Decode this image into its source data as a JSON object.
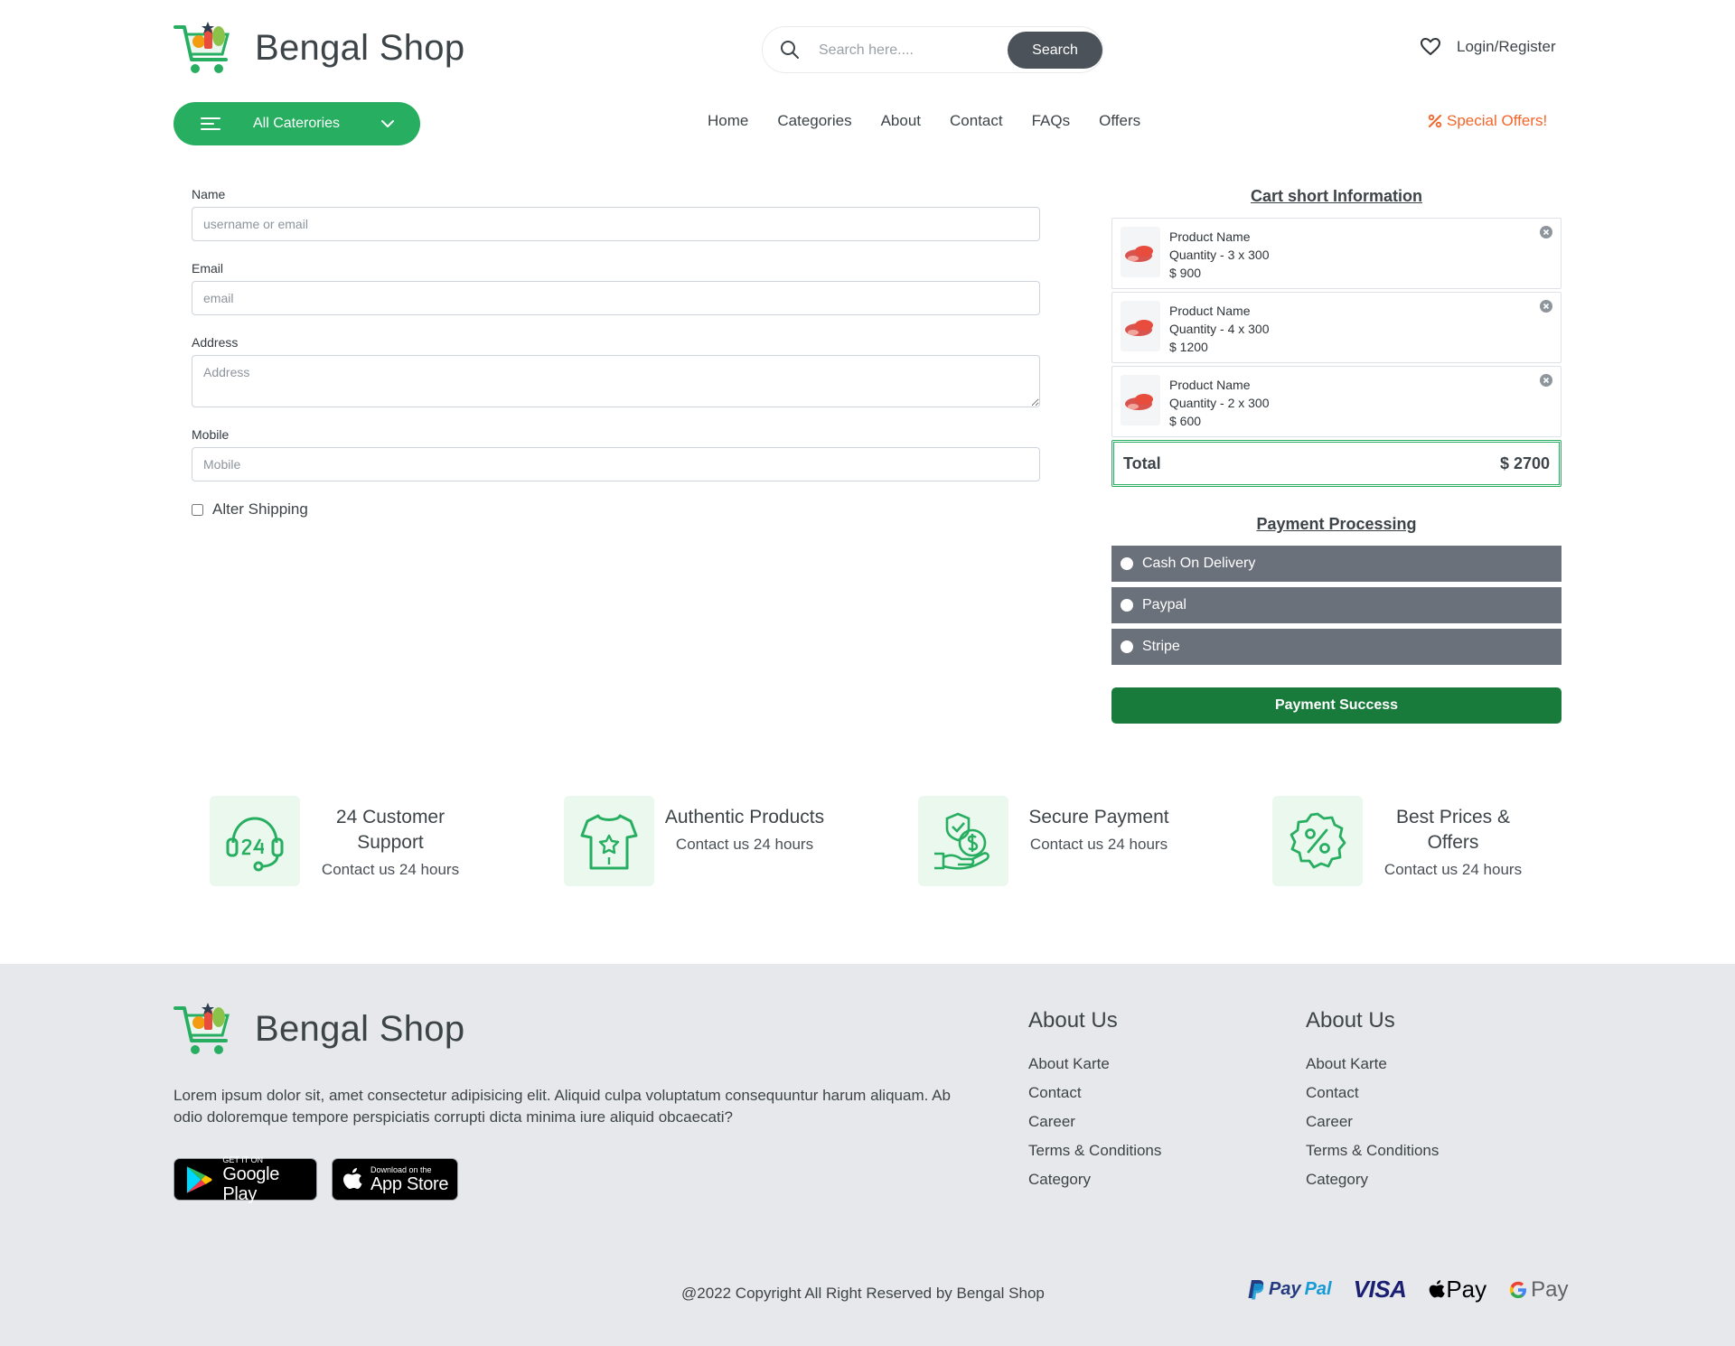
{
  "header": {
    "brand": "Bengal Shop",
    "search": {
      "placeholder": "Search here....",
      "button": "Search"
    },
    "login": "Login/Register",
    "categories_button": "All Caterories",
    "nav": [
      "Home",
      "Categories",
      "About",
      "Contact",
      "FAQs",
      "Offers"
    ],
    "special_offers": "Special Offers!"
  },
  "form": {
    "name": {
      "label": "Name",
      "placeholder": "username or email"
    },
    "email": {
      "label": "Email",
      "placeholder": "email"
    },
    "address": {
      "label": "Address",
      "placeholder": "Address"
    },
    "mobile": {
      "label": "Mobile",
      "placeholder": "Mobile"
    },
    "alter_shipping": "Alter Shipping"
  },
  "cart": {
    "title": "Cart short Information",
    "items": [
      {
        "name": "Product Name",
        "quantity": "Quantity - 3 x 300",
        "price": "$ 900"
      },
      {
        "name": "Product Name",
        "quantity": "Quantity - 4 x 300",
        "price": "$ 1200"
      },
      {
        "name": "Product Name",
        "quantity": "Quantity - 2 x 300",
        "price": "$ 600"
      }
    ],
    "total_label": "Total",
    "total_value": "$ 2700"
  },
  "payment": {
    "title": "Payment Processing",
    "options": [
      "Cash On Delivery",
      "Paypal",
      "Stripe"
    ],
    "button": "Payment Success"
  },
  "features": [
    {
      "icon": "headset-24-icon",
      "title": "24 Customer Support",
      "sub": "Contact us 24 hours"
    },
    {
      "icon": "tshirt-badge-icon",
      "title": "Authentic Products",
      "sub": "Contact us 24 hours"
    },
    {
      "icon": "secure-payment-icon",
      "title": "Secure Payment",
      "sub": "Contact us 24 hours"
    },
    {
      "icon": "discount-badge-icon",
      "title": "Best Prices & Offers",
      "sub": "Contact us 24 hours"
    }
  ],
  "footer": {
    "brand": "Bengal Shop",
    "description": "Lorem ipsum dolor sit, amet consectetur adipisicing elit. Aliquid culpa voluptatum consequuntur harum aliquam. Ab odio doloremque tempore perspiciatis corrupti dicta minima iure aliquid obcaecati?",
    "google_play": {
      "small": "GET IT ON",
      "big": "Google Play"
    },
    "app_store": {
      "small": "Download on the",
      "big": "App Store"
    },
    "columns": [
      {
        "title": "About Us",
        "links": [
          "About Karte",
          "Contact",
          "Career",
          "Terms & Conditions",
          "Category"
        ]
      },
      {
        "title": "About Us",
        "links": [
          "About Karte",
          "Contact",
          "Career",
          "Terms & Conditions",
          "Category"
        ]
      }
    ],
    "copyright": "@2022 Copyright All Right Reserved by Bengal Shop",
    "payment_logos": {
      "paypal_a": "Pay",
      "paypal_b": "Pal",
      "visa": "VISA",
      "apple_pay": "Pay",
      "google_pay": "Pay"
    }
  },
  "colors": {
    "accent": "#27ae60",
    "dark_button": "#4b525a",
    "pay_option": "#6b717b",
    "pay_success": "#187a3b",
    "offer": "#f4652a",
    "footer_bg": "#e6e8ec"
  }
}
